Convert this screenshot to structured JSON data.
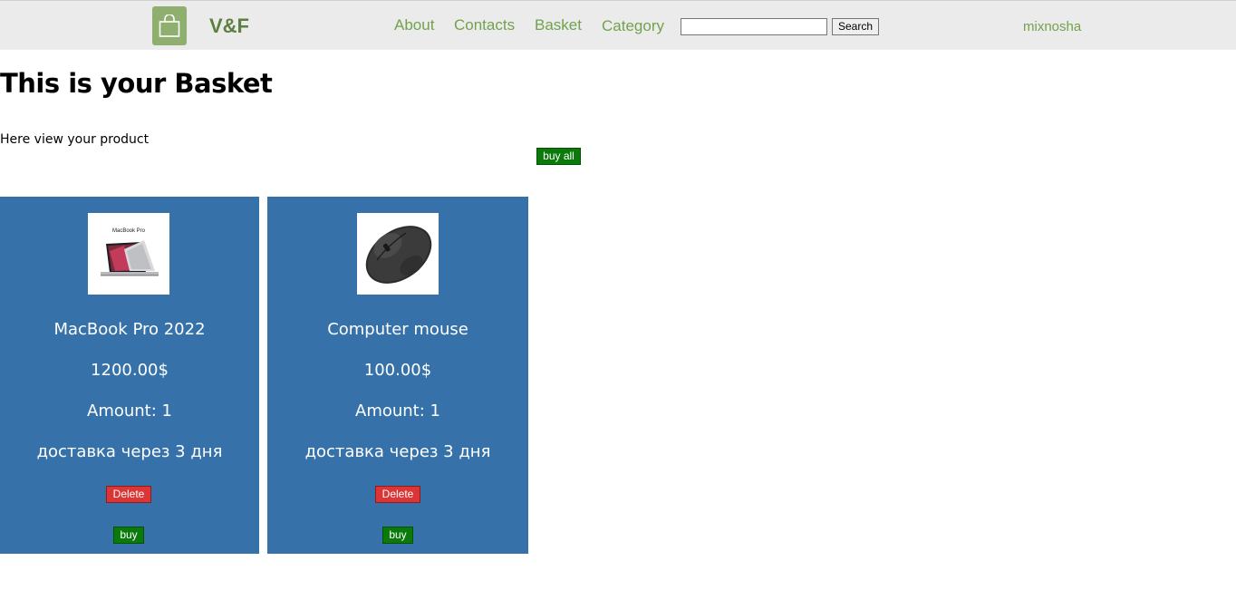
{
  "header": {
    "brand": "V&F",
    "nav": {
      "about": "About",
      "contacts": "Contacts",
      "basket": "Basket",
      "category": "Category"
    },
    "search": {
      "value": "",
      "button_label": "Search"
    },
    "username": "mixnosha"
  },
  "page": {
    "title": "This is your Basket",
    "subtitle": "Here view your product",
    "buy_all_label": "buy all"
  },
  "products": [
    {
      "name": "MacBook Pro 2022",
      "price": "1200.00$",
      "amount": "Amount: 1",
      "delivery": "доставка через 3 дня",
      "image_caption": "MacBook Pro",
      "delete_label": "Delete",
      "buy_label": "buy"
    },
    {
      "name": "Computer mouse",
      "price": "100.00$",
      "amount": "Amount: 1",
      "delivery": "доставка через 3 дня",
      "delete_label": "Delete",
      "buy_label": "buy"
    }
  ],
  "colors": {
    "topbar_bg": "#ecebec",
    "nav_link": "#71a24c",
    "brand": "#5d7f42",
    "logo_bg": "#8faf6e",
    "card_bg": "#3672a9",
    "buy_green": "#0a7a0a",
    "delete_red": "#dc3535"
  }
}
